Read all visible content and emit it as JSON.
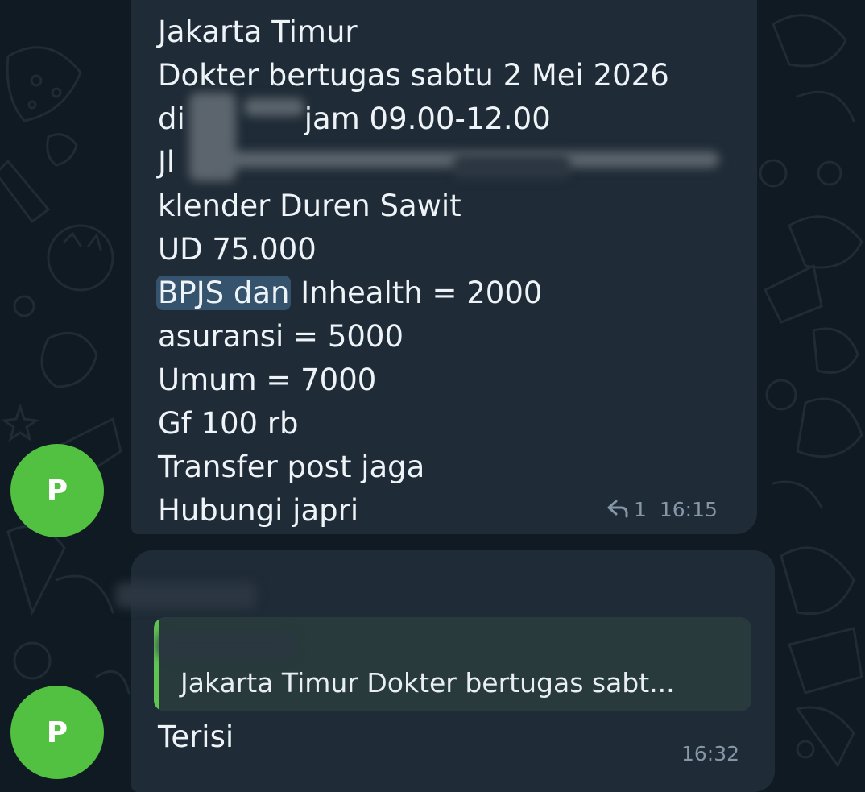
{
  "colors": {
    "background": "#0f1a22",
    "bubble": "#1f2b36",
    "avatar": "#52c040",
    "highlight": "#35536c",
    "reply_bar": "#5fc452",
    "meta_text": "#8597a6"
  },
  "messages": [
    {
      "avatar_letter": "P",
      "lines": [
        "Jakarta Timur",
        "Dokter bertugas sabtu 2 Mei 2026",
        "di",
        "Jl",
        "klender Duren Sawit",
        "UD 75.000",
        "BPJS dan Inhealth = 2000",
        "asuransi = 5000",
        "Umum = 7000",
        "Gf 100 rb",
        "Transfer post jaga",
        "Hubungi japri"
      ],
      "line3_suffix": "jam 09.00-12.00",
      "highlight_text": "BPJS dan",
      "highlight_rest": " Inhealth = 2000",
      "reply_icon": "reply-arrow-icon",
      "reply_count": "1",
      "time": "16:15"
    },
    {
      "avatar_letter": "P",
      "quoted_text": "Jakarta Timur  Dokter bertugas sabt...",
      "text": "Terisi",
      "time": "16:32"
    }
  ]
}
